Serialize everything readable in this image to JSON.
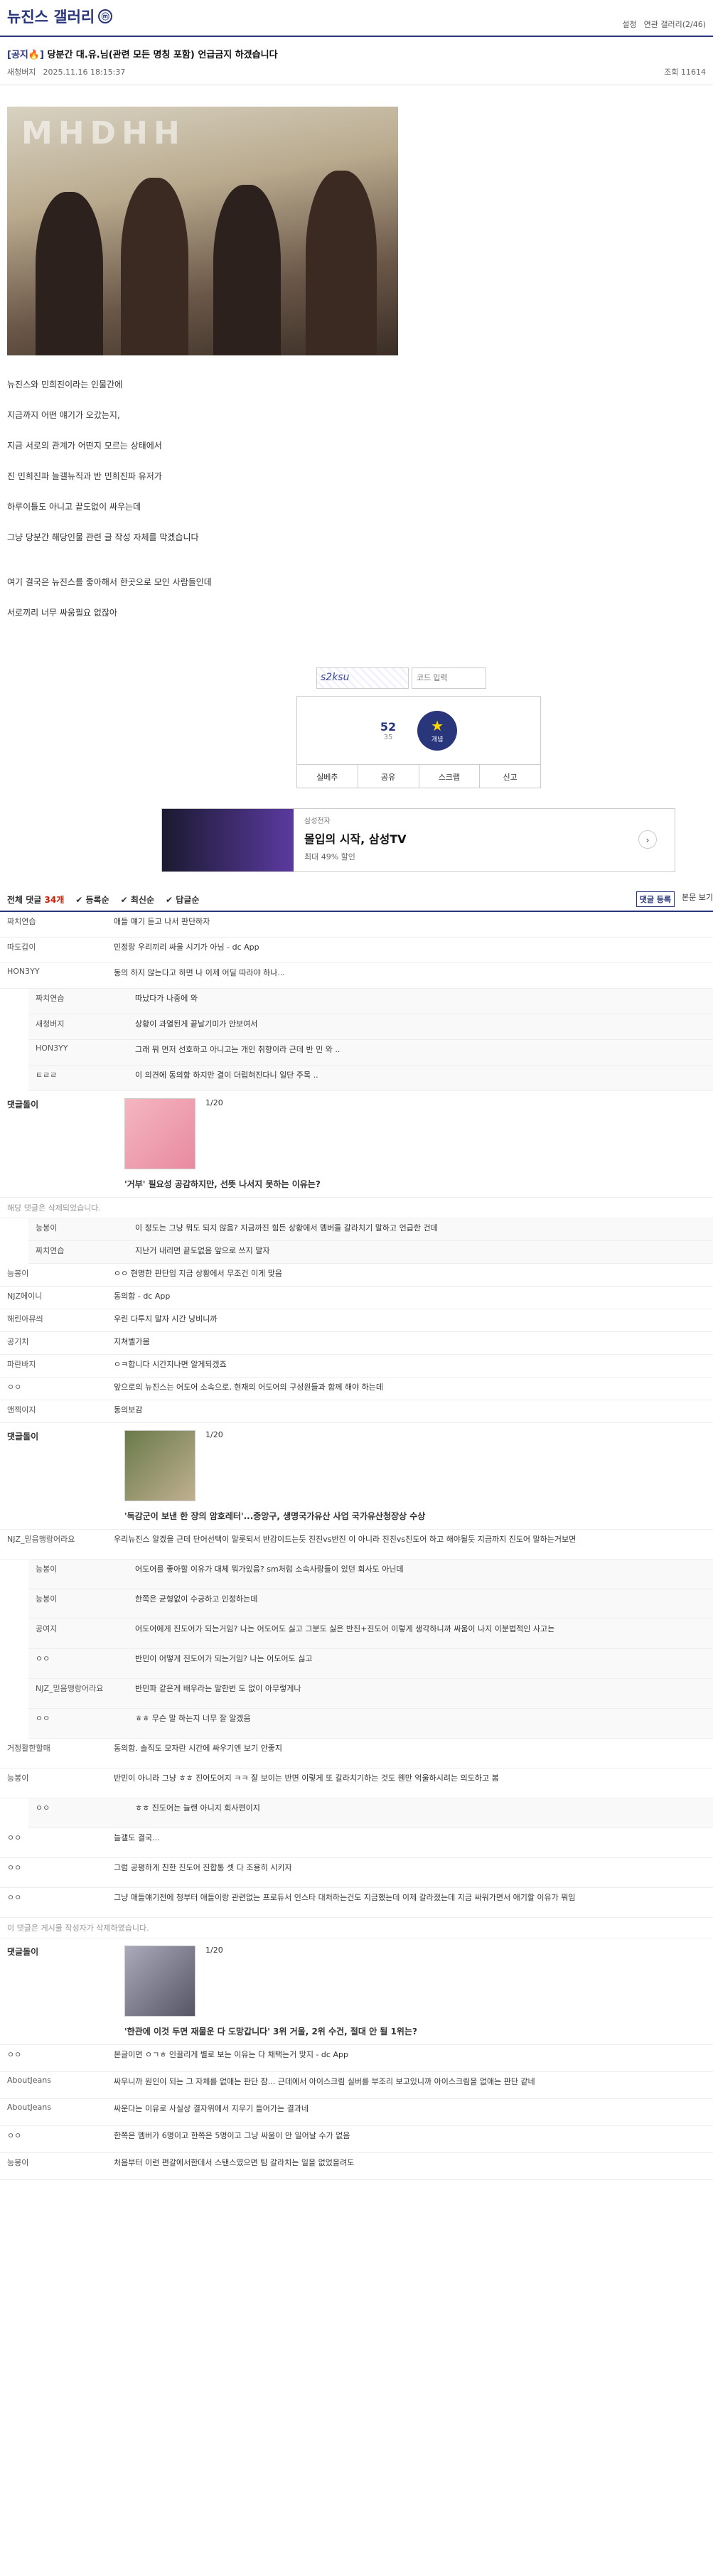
{
  "header": {
    "title": "뉴진스 갤러리",
    "badge": "ⓜ",
    "setting": "설정",
    "related": "연관 갤러리(2/46)"
  },
  "post": {
    "category": "[공지🔥]",
    "title": "당분간 대.유.님(관련 모든 명칭 포함) 언급금지 하겠습니다",
    "writer": "새청버지",
    "date": "2025.11.16 18:15:37",
    "views": "조회 11614",
    "photo_text": "MHDHH",
    "body": [
      "뉴진스와 민희진이라는 인물간에",
      "지금까지 어떤 얘기가 오갔는지,",
      "지금 서로의 관계가 어떤지 모르는 상태에서",
      "진 민희진파 늘갤뉴직과 반 민희진파 유저가",
      "하루이틀도 아니고 끝도없이 싸우는데",
      "그냥 당분간 해당인물 관련 글 작성 자체를 막겠습니다",
      "",
      "여기 결국은 뉴진스를 좋아해서 한곳으로 모인 사람들인데",
      "서로끼리 너무 싸움필요 없잖아"
    ]
  },
  "captcha": {
    "placeholder": "코드 입력",
    "code": "s2ksu"
  },
  "vote": {
    "up": "52",
    "fixed": "35",
    "label": "개념",
    "actions": [
      "실베추",
      "공유",
      "스크랩",
      "신고"
    ]
  },
  "ad": {
    "brand": "삼성전자",
    "headline": "몰입의 시작, 삼성TV",
    "desc": "최대 49% 할인"
  },
  "comments_bar": {
    "all": "전체 댓글",
    "count": "34개",
    "sorts": [
      "✔ 등록순",
      "✔ 최신순",
      "✔ 답글순"
    ],
    "btn": "댓글 등록",
    "btn2": "본문 보기"
  },
  "comments": [
    {
      "nick": "짜치연습",
      "text": "애들 얘기 듣고 나서 판단하자"
    },
    {
      "nick": "따도갑이",
      "text": "민정랑 우리끼리 싸울 시기가 아님 - dc App"
    },
    {
      "nick": "HON3YY",
      "text": "동의 하지 않는다고 하면 나 이제 어딜 따라야 하나..."
    },
    {
      "nick": "짜치연습",
      "text": "따났다가 나중에 와",
      "rep": true
    },
    {
      "nick": "새청버지",
      "text": "상황이 과열된게 끝날기미가 안보여서",
      "rep": true
    },
    {
      "nick": "HON3YY",
      "text": "그래 뭐 먼저 선호하고 아니고는 개인 취향이라 근데 반 민 와 ..",
      "rep": true
    },
    {
      "nick": "ㅌㄹㄹ",
      "text": "이 의견에 동의함 하지만 결이 더럽혀진다니 일단 주목 ..",
      "rep": true
    }
  ],
  "dccon": [
    {
      "label": "댓글돌이",
      "page": "1/20",
      "caption": "'거부' 필요성 공감하지만, 선뜻 나서지 못하는 이유는?"
    },
    {
      "label": "댓글돌이",
      "page": "1/20",
      "caption": "'독감군이 보낸 한 장의 암호레터'...중앙구, 생명국가유산 사업 국가유산청장상 수상"
    },
    {
      "label": "댓글돌이",
      "page": "1/20",
      "caption": "'한관에 이것 두면 재물운 다 도망갑니다' 3위 거울, 2위 수건, 절대 안 될 1위는?"
    }
  ],
  "note": "해당 댓글은 삭제되었습니다.",
  "comments2": [
    {
      "nick": "능봉이",
      "text": "이 정도는 그냥 뭐도 되지 않음? 지금까진 힘든 상황에서 멤버들 갈라치기 말하고 언급한 건데",
      "rep": true
    },
    {
      "nick": "짜치연습",
      "text": "지난거 내리면 끝도없음 앞으로 쓰지 말자",
      "rep": true
    },
    {
      "nick": "능봉이",
      "text": "ㅇㅇ 현명한 판단임 지금 상황에서 무조건 이게 맞음"
    },
    {
      "nick": "NJZ에이니",
      "text": "동의함 - dc App"
    },
    {
      "nick": "해린아뮤씌",
      "text": "우린 다투지 말자 시간 낭비니까"
    },
    {
      "nick": "공기치",
      "text": "지쳐벨가봄"
    },
    {
      "nick": "파란바지",
      "text": "ㅇㅋ합니다 시간지나면 알게되겠죠"
    },
    {
      "nick": "ㅇㅇ",
      "text": "앞으로의 뉴진스는 어도어 소속으로, 현재의 어도어의 구성원들과 함께 해야 하는데"
    },
    {
      "nick": "앤젝이지",
      "text": "동의보감"
    }
  ],
  "comments3": [
    {
      "nick": "NJZ_믿음맹랑어라요",
      "text": "우리뉴진스 알겠을 근데 단어선택이 말룻되서 반감이드는듯 진진vs반진 이 아니라 진진vs진도어 하고 해야될듯 지금까지 진도어 말하는거보면"
    },
    {
      "nick": "능봉이",
      "text": "어도어를 좋아할 이유가 대체 뭐가있음? sm처럼 소속사랑들이 있던 회사도 아닌데",
      "rep": true
    },
    {
      "nick": "능봉이",
      "text": "한쪽은 균형없이 수긍하고 인정하는데",
      "rep": true
    },
    {
      "nick": "공여지",
      "text": "어도어에게 진도어가 되는거임? 나는 어도어도 싫고 그분도 싫은 반진+진도어 이렇게 생각하니까 싸움이 나지 이분법적인 사고는",
      "rep": true
    },
    {
      "nick": "ㅇㅇ",
      "text": "반민이 어떻게 진도어가 되는거임? 나는 어도어도 싫고",
      "rep": true
    },
    {
      "nick": "NJZ_믿음맹랑어라요",
      "text": "반민파 같은게 배우라는 말한번 도 없이 아무렇게나",
      "rep": true
    },
    {
      "nick": "ㅇㅇ",
      "text": "ㅎㅎ 무슨 말 하는지 너무 잘 알겠음",
      "rep": true
    },
    {
      "nick": "거정활한할매",
      "text": "동의함. 솔직도 모자란 시간에 싸우기엔 보기 안좋지"
    },
    {
      "nick": "능봉이",
      "text": "반민이 아니라 그냥 ㅎㅎ 진어도어지 ㅋㅋ 잘 보이는 반면 이렇게 또 갈라치기하는 것도 웬만 억울하시려는 의도하고 봄"
    },
    {
      "nick": "ㅇㅇ",
      "text": "ㅎㅎ 진도어는 늘랜 아니지 회사편이지",
      "rep": true
    },
    {
      "nick": "ㅇㅇ",
      "text": "늘갤도 결국..."
    },
    {
      "nick": "ㅇㅇ",
      "text": "그럼 공평하게 친한 진도어 진합통 셋 다 조용히 시키자"
    },
    {
      "nick": "ㅇㅇ",
      "text": "그냥 애들얘기전에 청부터 애들이랑 관련없는 프로듀서 인스타 대처하는건도 지금했는데 이제 갈라졌는데 지금 싸워가면서 애기할 이유가 뭐임"
    }
  ],
  "note2": "이 댓글은 게시물 작성자가 삭제하였습니다.",
  "comments4": [
    {
      "nick": "ㅇㅇ",
      "text": "본글이면 ㅇㄱㅎ 인끌리게 별로 보는 이유는 다 채택는거 맞지 - dc App"
    },
    {
      "nick": "AboutJeans",
      "text": "싸우니까 원인이 되는 그 자체를 없애는 판단 참... 근데에서 아이스크림 실버를 부조리 보고있니까 아이스크림을 없애는 판단 같네"
    },
    {
      "nick": "AboutJeans",
      "text": "싸운다는 이유로 사실상 결자위에서 지우기 들어가는 결과네"
    },
    {
      "nick": "ㅇㅇ",
      "text": "한쪽은 멤버가 6명이고 한쪽은 5명이고 그냥 싸움이 안 일어날 수가 없음"
    },
    {
      "nick": "능봉이",
      "text": "처음부터 이런 편갈에서한데서 스탠스였으면 팀 갈라치는 일을 없었을려도"
    }
  ]
}
